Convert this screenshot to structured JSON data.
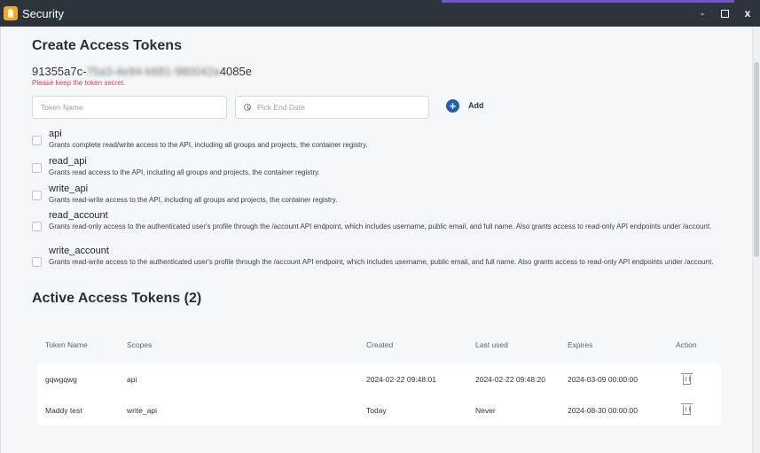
{
  "window": {
    "title": "Security",
    "minimize_glyph": "-",
    "close_glyph": "x"
  },
  "create": {
    "title": "Create Access Tokens",
    "token_prefix": "91355a7c-",
    "token_blurred": "75a3-4e94-b681-980042a",
    "token_suffix": "4085e",
    "warning": "Please keep the token secret.",
    "token_name_placeholder": "Token Name",
    "end_date_placeholder": "Pick End Date",
    "add_label": "Add"
  },
  "scopes": [
    {
      "name": "api",
      "description": "Grants complete read/write access to the API, including all groups and projects, the container registry."
    },
    {
      "name": "read_api",
      "description": "Grants read access to the API, including all groups and projects, the container registry."
    },
    {
      "name": "write_api",
      "description": "Grants read-write access to the API, including all groups and projects, the container registry."
    },
    {
      "name": "read_account",
      "description": "Grants read-only access to the authenticated user's profile through the /account API endpoint, which includes username, public email, and full name. Also grants access to read-only API endpoints under /account."
    },
    {
      "name": "write_account",
      "description": "Grants read-write access to the authenticated user's profile through the /account API endpoint, which includes username, public email, and full name. Also grants access to read-only API endpoints under /account."
    }
  ],
  "active": {
    "title": "Active Access Tokens (2)",
    "columns": [
      "Token Name",
      "Scopes",
      "Created",
      "Last used",
      "Expires",
      "Action"
    ],
    "rows": [
      {
        "name": "gqwgqwg",
        "scopes": "api",
        "created": "2024-02-22 09:48:01",
        "last_used": "2024-02-22 09:48:20",
        "expires": "2024-03-09 00:00:00"
      },
      {
        "name": "Maddy test",
        "scopes": "write_api",
        "created": "Today",
        "last_used": "Never",
        "expires": "2024-08-30 00:00:00"
      }
    ]
  },
  "colors": {
    "titlebar": "#2e343b",
    "accent": "#6f55c7",
    "add_button": "#1f5fae",
    "warning": "#e0464b"
  },
  "icons": [
    "app-icon",
    "minimize-icon",
    "maximize-icon",
    "close-icon",
    "clock-icon",
    "plus-icon",
    "trash-icon"
  ]
}
